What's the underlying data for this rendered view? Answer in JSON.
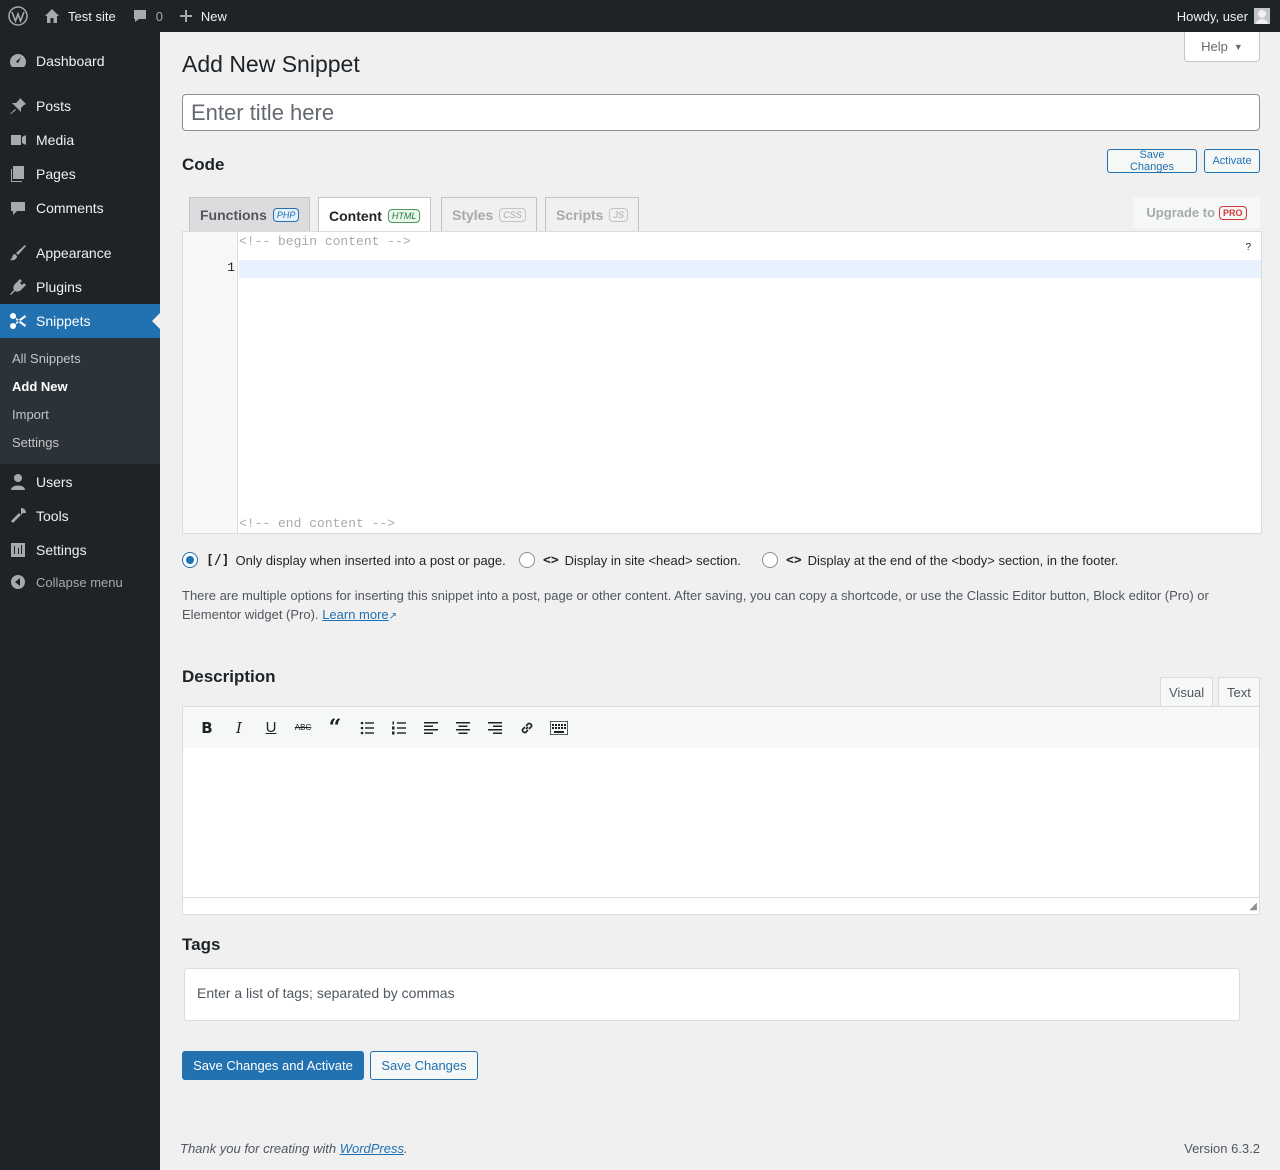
{
  "adminbar": {
    "site_name": "Test site",
    "comments_count": "0",
    "new_label": "New",
    "greeting": "Howdy, user"
  },
  "sidebar": {
    "items": [
      {
        "label": "Dashboard",
        "icon": "dashboard-icon"
      },
      {
        "label": "Posts",
        "icon": "pin-icon"
      },
      {
        "label": "Media",
        "icon": "media-icon"
      },
      {
        "label": "Pages",
        "icon": "pages-icon"
      },
      {
        "label": "Comments",
        "icon": "comment-icon"
      },
      {
        "label": "Appearance",
        "icon": "brush-icon"
      },
      {
        "label": "Plugins",
        "icon": "plugin-icon"
      },
      {
        "label": "Snippets",
        "icon": "scissors-icon"
      },
      {
        "label": "Users",
        "icon": "user-icon"
      },
      {
        "label": "Tools",
        "icon": "wrench-icon"
      },
      {
        "label": "Settings",
        "icon": "settings-icon"
      }
    ],
    "submenu": [
      "All Snippets",
      "Add New",
      "Import",
      "Settings"
    ],
    "collapse_label": "Collapse menu"
  },
  "header": {
    "help_label": "Help",
    "page_title": "Add New Snippet",
    "title_placeholder": "Enter title here"
  },
  "code_section": {
    "heading": "Code",
    "save_label": "Save Changes",
    "activate_label": "Activate",
    "tabs": [
      {
        "label": "Functions",
        "badge": "PHP"
      },
      {
        "label": "Content",
        "badge": "HTML"
      },
      {
        "label": "Styles",
        "badge": "CSS"
      },
      {
        "label": "Scripts",
        "badge": "JS"
      }
    ],
    "upgrade_label": "Upgrade to",
    "upgrade_badge": "PRO",
    "editor": {
      "begin_comment": "<!-- begin content -->",
      "end_comment": "<!-- end content -->",
      "line_number": "1",
      "help_mark": "?"
    }
  },
  "scope": {
    "options": [
      {
        "icon": "[/]",
        "label": "Only display when inserted into a post or page.",
        "checked": true
      },
      {
        "icon": "<>",
        "label": "Display in site <head> section.",
        "checked": false
      },
      {
        "icon": "<>",
        "label": "Display at the end of the <body> section, in the footer.",
        "checked": false
      }
    ],
    "description": "There are multiple options for inserting this snippet into a post, page or other content. After saving, you can copy a shortcode, or use the Classic Editor button, Block editor (Pro) or Elementor widget (Pro).",
    "learn_more": "Learn more"
  },
  "description_section": {
    "heading": "Description",
    "tab_visual": "Visual",
    "tab_text": "Text"
  },
  "tags_section": {
    "heading": "Tags",
    "placeholder": "Enter a list of tags; separated by commas"
  },
  "actions": {
    "save_activate": "Save Changes and Activate",
    "save": "Save Changes"
  },
  "footer": {
    "thanks_prefix": "Thank you for creating with",
    "wp_link": "WordPress",
    "thanks_suffix": ".",
    "version": "Version 6.3.2"
  },
  "colors": {
    "accent": "#2271b1",
    "sidebar_bg": "#1d2327",
    "submenu_bg": "#2c3338",
    "page_bg": "#f0f0f1"
  }
}
